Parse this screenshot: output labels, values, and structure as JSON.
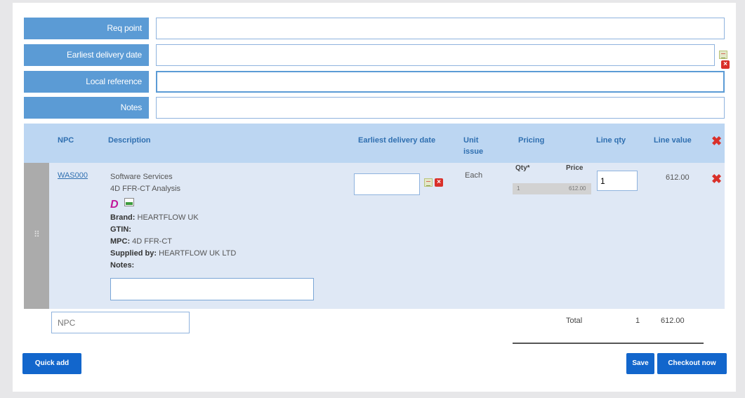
{
  "form": {
    "req_point_label": "Req point",
    "req_point_value": "",
    "earliest_delivery_label": "Earliest delivery date",
    "earliest_delivery_value": "",
    "local_reference_label": "Local reference",
    "local_reference_value": "",
    "notes_label": "Notes",
    "notes_value": ""
  },
  "table": {
    "headers": {
      "npc": "NPC",
      "description": "Description",
      "earliest_delivery": "Earliest delivery date",
      "unit_issue": "Unit issue",
      "pricing": "Pricing",
      "line_qty": "Line qty",
      "line_value": "Line value"
    },
    "row": {
      "npc": "WAS000",
      "description_1": "Software Services",
      "description_2": "4D FFR-CT Analysis",
      "brand_label": "Brand:",
      "brand_value": "HEARTFLOW UK",
      "gtin_label": "GTIN:",
      "gtin_value": "",
      "mpc_label": "MPC:",
      "mpc_value": "4D FFR-CT",
      "supplied_by_label": "Supplied by:",
      "supplied_by_value": "HEARTFLOW UK LTD",
      "notes_label": "Notes:",
      "notes_value": "",
      "delivery_date_value": "",
      "unit_issue": "Each",
      "pricing_qty_header": "Qty*",
      "pricing_price_header": "Price",
      "pricing_qty": "1",
      "pricing_price": "612.00",
      "line_qty": "1",
      "line_value": "612.00",
      "handle_glyph": "⠿"
    }
  },
  "npc_input": {
    "placeholder": "NPC",
    "value": ""
  },
  "totals": {
    "label": "Total",
    "qty": "1",
    "value": "612.00"
  },
  "buttons": {
    "quick_add": "Quick add",
    "save": "Save",
    "checkout": "Checkout now"
  },
  "icons": {
    "calendar": "calendar-icon",
    "clear": "clear-date-icon",
    "remove": "remove-line-icon"
  },
  "colors": {
    "label_bg": "#5b9bd5",
    "header_bg": "#bcd6f2",
    "row_bg": "#dfe8f5",
    "button_bg": "#1266cc",
    "remove_red": "#d9302a"
  }
}
